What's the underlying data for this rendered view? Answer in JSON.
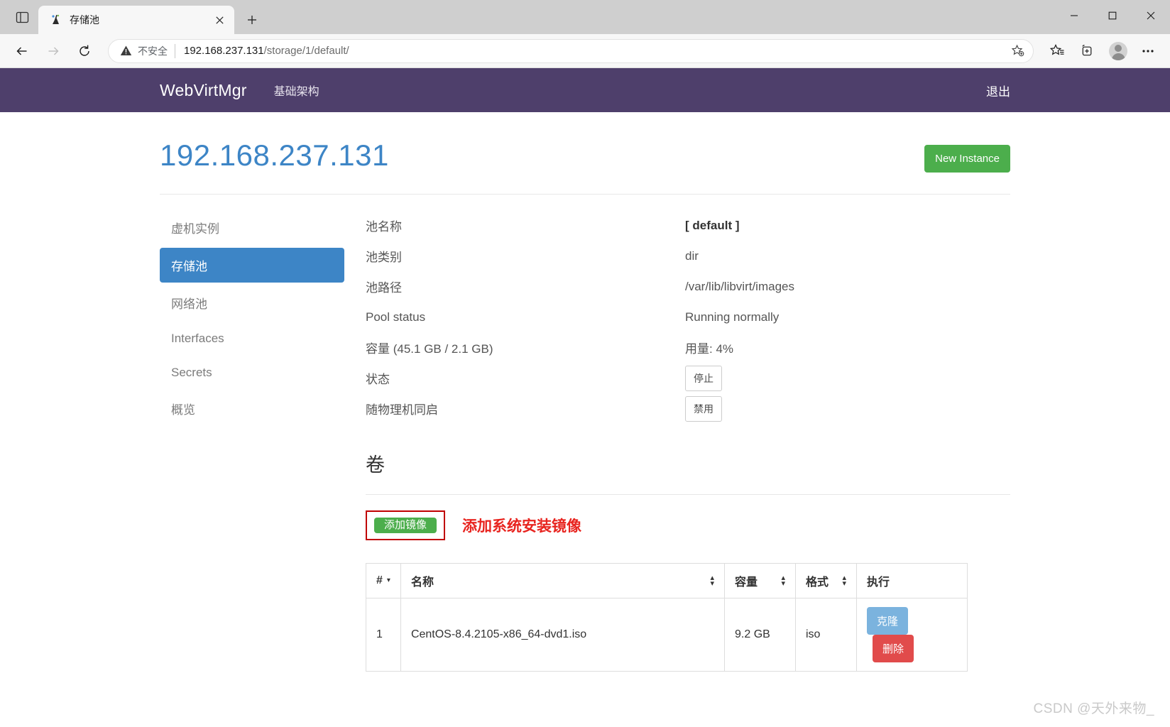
{
  "browser": {
    "tab": {
      "title": "存储池",
      "favicon_icon": "webvirtmgr-favicon",
      "close_icon": "close-icon"
    },
    "new_tab_icon": "plus-icon",
    "sidebar_toggle_icon": "tab-sidebar-icon",
    "window": {
      "minimize_icon": "minimize-icon",
      "maximize_icon": "maximize-icon",
      "close_icon": "window-close-icon"
    },
    "nav": {
      "back_icon": "back-arrow-icon",
      "forward_icon": "forward-arrow-icon",
      "reload_icon": "reload-icon"
    },
    "omnibox": {
      "warning_icon": "warning-triangle-icon",
      "security_label": "不安全",
      "url_host": "192.168.237.131",
      "url_path": "/storage/1/default/",
      "favorite_icon": "add-favorite-star-icon"
    },
    "toolbar_icons": [
      "favorites-star-icon",
      "collections-icon",
      "profile-avatar-icon",
      "more-settings-icon"
    ]
  },
  "navbar": {
    "brand": "WebVirtMgr",
    "links": [
      {
        "label": "基础架构"
      }
    ],
    "logout": "退出",
    "bg_color": "#4e3f6b"
  },
  "header": {
    "title": "192.168.237.131",
    "title_color": "#3d85c6",
    "new_instance_button": "New Instance",
    "new_instance_color": "#4cae4c"
  },
  "sidebar": {
    "items": [
      {
        "label": "虚机实例",
        "active": false
      },
      {
        "label": "存储池",
        "active": true
      },
      {
        "label": "网络池",
        "active": false
      },
      {
        "label": "Interfaces",
        "active": false
      },
      {
        "label": "Secrets",
        "active": false
      },
      {
        "label": "概览",
        "active": false
      }
    ],
    "active_color": "#3d85c6"
  },
  "details": {
    "rows": [
      {
        "label": "池名称",
        "value": "[ default ]",
        "bold": true
      },
      {
        "label": "池类别",
        "value": "dir",
        "bold": false
      },
      {
        "label": "池路径",
        "value": "/var/lib/libvirt/images",
        "bold": false
      },
      {
        "label": "Pool status",
        "value": "Running normally",
        "bold": false
      },
      {
        "label": "容量 (45.1 GB / 2.1 GB)",
        "value": "用量: 4%",
        "bold": false
      },
      {
        "label": "状态",
        "value": "停止",
        "is_button": true
      },
      {
        "label": "随物理机同启",
        "value": "禁用",
        "is_button": true
      }
    ]
  },
  "volumes": {
    "heading": "卷",
    "add_image_button": "添加镜像",
    "annotation_text": "添加系统安装镜像",
    "annotation_color": "#e8241f",
    "table": {
      "columns": [
        {
          "label": "#",
          "sort": "caret"
        },
        {
          "label": "名称",
          "sort": "updown"
        },
        {
          "label": "容量",
          "sort": "updown"
        },
        {
          "label": "格式",
          "sort": "updown"
        },
        {
          "label": "执行",
          "sort": "none"
        }
      ],
      "rows": [
        {
          "num": "1",
          "name": "CentOS-8.4.2105-x86_64-dvd1.iso",
          "capacity": "9.2 GB",
          "format": "iso",
          "clone_label": "克隆",
          "delete_label": "删除"
        }
      ]
    }
  },
  "watermark": "CSDN @天外来物_"
}
